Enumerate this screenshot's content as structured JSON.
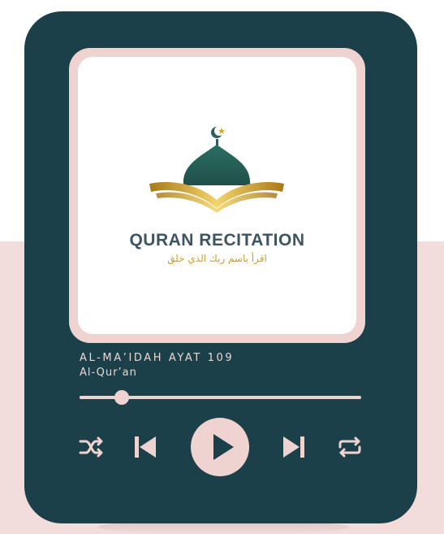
{
  "album_art": {
    "logo_title": "QURAN RECITATION",
    "logo_arabic": "اقرأ باسم ربك الذي خلق",
    "icon": "mosque-dome-book-logo"
  },
  "track": {
    "title": "AL-MA’IDAH AYAT 109",
    "artist": "Al-Qur’an"
  },
  "player": {
    "progress": 0.15,
    "controls": [
      "shuffle-icon",
      "previous-icon",
      "play-icon",
      "next-icon",
      "repeat-icon"
    ]
  },
  "colors": {
    "card": "#1c4049",
    "accent": "#efd3d0",
    "background_band": "#f2dcdc",
    "gold": "#c9a227"
  }
}
